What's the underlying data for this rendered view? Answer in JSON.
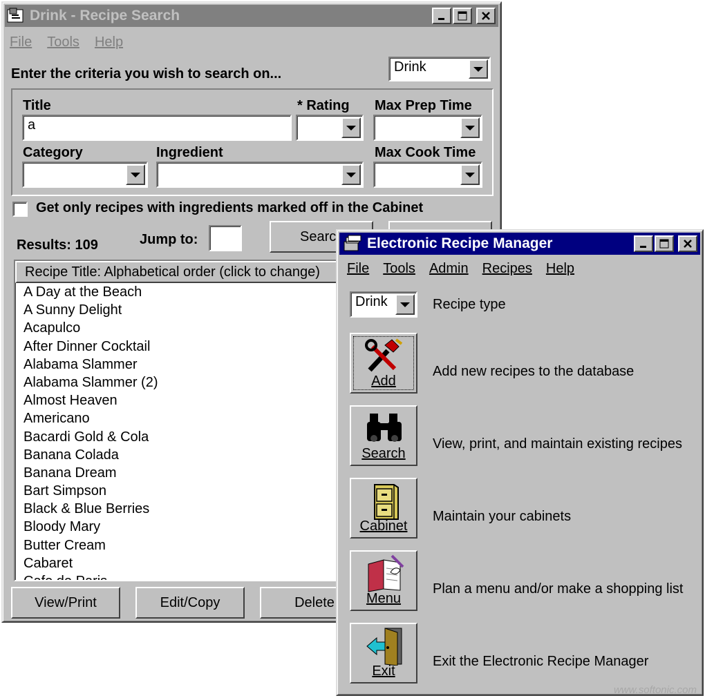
{
  "search_window": {
    "title": "Drink - Recipe Search",
    "menu": [
      "File",
      "Tools",
      "Help"
    ],
    "prompt": "Enter the criteria you wish to search on...",
    "type_select": "Drink",
    "fields": {
      "title_label": "Title",
      "title_value": "a",
      "rating_label": "* Rating",
      "max_prep_label": "Max Prep Time",
      "category_label": "Category",
      "ingredient_label": "Ingredient",
      "max_cook_label": "Max Cook Time"
    },
    "cabinet_checkbox_label": "Get only recipes with ingredients marked off in the Cabinet",
    "cabinet_checked": false,
    "results_label": "Results: 109",
    "jump_label": "Jump to:",
    "search_button": "Search",
    "list_header": "Recipe Title: Alphabetical order (click to change)",
    "recipes": [
      "A Day at the Beach",
      "A Sunny Delight",
      "Acapulco",
      "After Dinner Cocktail",
      "Alabama Slammer",
      "Alabama Slammer (2)",
      "Almost Heaven",
      "Americano",
      "Bacardi Gold & Cola",
      "Banana Colada",
      "Banana Dream",
      "Bart Simpson",
      "Black & Blue Berries",
      "Bloody Mary",
      "Butter Cream",
      "Cabaret",
      "Cafe de Paris"
    ],
    "buttons": {
      "view_print": "View/Print",
      "edit_copy": "Edit/Copy",
      "delete": "Delete"
    }
  },
  "manager_window": {
    "title": "Electronic Recipe Manager",
    "menu": [
      "File",
      "Tools",
      "Admin",
      "Recipes",
      "Help"
    ],
    "type_select": "Drink",
    "type_label": "Recipe type",
    "actions": [
      {
        "label": "Add",
        "icon": "tools-icon",
        "desc": "Add new recipes to the database"
      },
      {
        "label": "Search",
        "icon": "binoculars-icon",
        "desc": "View, print, and maintain existing recipes"
      },
      {
        "label": "Cabinet",
        "icon": "cabinet-icon",
        "desc": "Maintain your cabinets"
      },
      {
        "label": "Menu",
        "icon": "notebook-icon",
        "desc": "Plan a menu and/or make a shopping list"
      },
      {
        "label": "Exit",
        "icon": "exit-door-icon",
        "desc": "Exit the Electronic Recipe Manager"
      }
    ]
  },
  "watermark": "www.softonic.com",
  "colors": {
    "face": "#c0c0c0",
    "active_title": "#000080",
    "inactive_title": "#808080"
  }
}
